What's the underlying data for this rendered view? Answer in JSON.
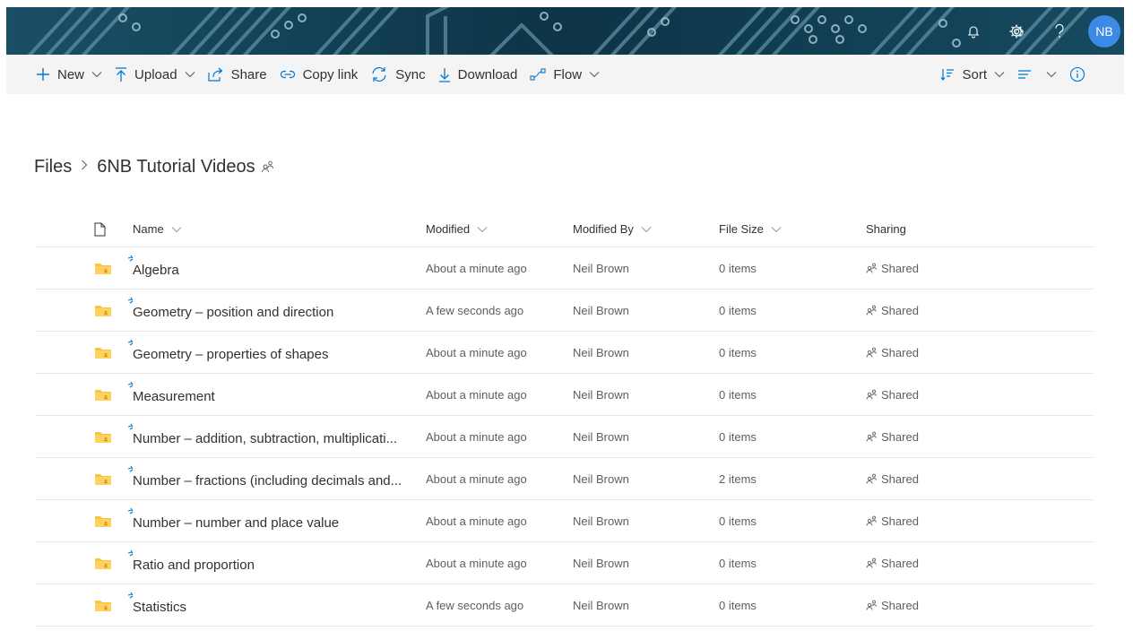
{
  "header": {
    "avatar_initials": "NB",
    "icons": [
      "bell-icon",
      "gear-icon",
      "help-icon"
    ]
  },
  "toolbar": {
    "new_label": "New",
    "upload_label": "Upload",
    "share_label": "Share",
    "copy_link_label": "Copy link",
    "sync_label": "Sync",
    "download_label": "Download",
    "flow_label": "Flow",
    "sort_label": "Sort"
  },
  "breadcrumb": {
    "root": "Files",
    "current": "6NB Tutorial Videos"
  },
  "columns": {
    "name": "Name",
    "modified": "Modified",
    "modified_by": "Modified By",
    "file_size": "File Size",
    "sharing": "Sharing"
  },
  "rows": [
    {
      "name": "Algebra",
      "modified": "About a minute ago",
      "by": "Neil Brown",
      "size": "0 items",
      "sharing": "Shared"
    },
    {
      "name": "Geometry – position and direction",
      "modified": "A few seconds ago",
      "by": "Neil Brown",
      "size": "0 items",
      "sharing": "Shared"
    },
    {
      "name": "Geometry – properties of shapes",
      "modified": "About a minute ago",
      "by": "Neil Brown",
      "size": "0 items",
      "sharing": "Shared"
    },
    {
      "name": "Measurement",
      "modified": "About a minute ago",
      "by": "Neil Brown",
      "size": "0 items",
      "sharing": "Shared"
    },
    {
      "name": "Number – addition, subtraction, multiplicati...",
      "modified": "About a minute ago",
      "by": "Neil Brown",
      "size": "0 items",
      "sharing": "Shared"
    },
    {
      "name": "Number – fractions (including decimals and...",
      "modified": "About a minute ago",
      "by": "Neil Brown",
      "size": "2 items",
      "sharing": "Shared"
    },
    {
      "name": "Number – number and place value",
      "modified": "About a minute ago",
      "by": "Neil Brown",
      "size": "0 items",
      "sharing": "Shared"
    },
    {
      "name": "Ratio and proportion",
      "modified": "About a minute ago",
      "by": "Neil Brown",
      "size": "0 items",
      "sharing": "Shared"
    },
    {
      "name": "Statistics",
      "modified": "A few seconds ago",
      "by": "Neil Brown",
      "size": "0 items",
      "sharing": "Shared"
    }
  ],
  "colors": {
    "accent": "#0078d4",
    "banner": "#0f3b4f",
    "folder": "#f8c33d",
    "avatar": "#3a8ae6"
  }
}
